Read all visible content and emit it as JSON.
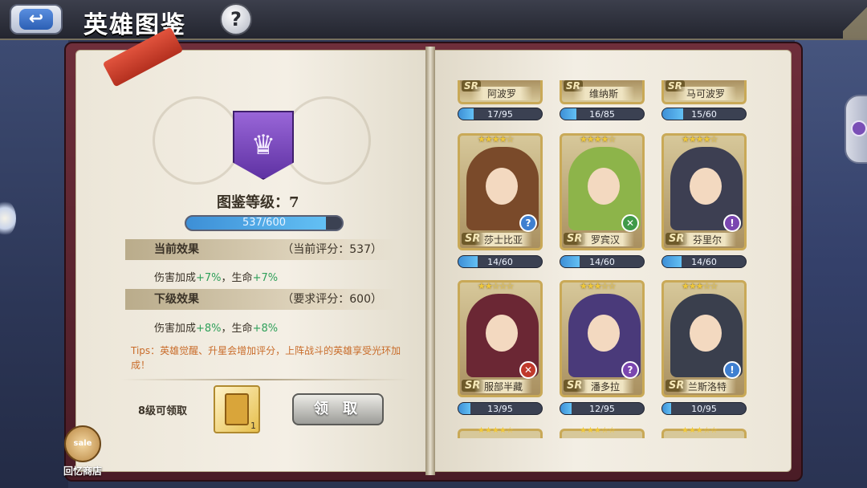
{
  "header": {
    "back_icon": "back-arrow-icon",
    "title": "英雄图鉴",
    "help_label": "?"
  },
  "left_page": {
    "emblem_icon": "winged-crown-emblem-icon",
    "level_label": "图鉴等级：7",
    "progress_text": "537/600",
    "progress_fraction": 0.895,
    "current": {
      "title": "当前效果",
      "score": "（当前评分：537）",
      "effect_prefix": "伤害加成",
      "effect_dmg": "+7%",
      "effect_mid": "，生命",
      "effect_hp": "+7%"
    },
    "next": {
      "title": "下级效果",
      "score": "（要求评分：600）",
      "effect_prefix": "伤害加成",
      "effect_dmg": "+8%",
      "effect_mid": "，生命",
      "effect_hp": "+8%"
    },
    "tips": "Tips：英雄觉醒、升星会增加评分，上阵战斗的英雄享受光环加成！",
    "claim_label": "8级可领取",
    "reward_count": "1",
    "claim_button": "领 取"
  },
  "shop": {
    "badge": "sale",
    "label": "回忆商店"
  },
  "heroes_top": [
    {
      "name": "阿波罗",
      "progress": "17/95",
      "fraction": 0.18
    },
    {
      "name": "维纳斯",
      "progress": "16/85",
      "fraction": 0.19
    },
    {
      "name": "马可波罗",
      "progress": "15/60",
      "fraction": 0.25
    }
  ],
  "heroes": [
    {
      "name": "莎士比亚",
      "stars": "★★★★☆",
      "rarity": "SR",
      "class_icon": "question-class-icon",
      "class_glyph": "?",
      "class_color": "#3f7fd0",
      "progress": "14/60",
      "fraction": 0.23,
      "art_color": "#7a4a2a"
    },
    {
      "name": "罗宾汉",
      "stars": "★★★★☆",
      "rarity": "SR",
      "class_icon": "crossed-bow-class-icon",
      "class_glyph": "✕",
      "class_color": "#3f9a48",
      "progress": "14/60",
      "fraction": 0.23,
      "art_color": "#8db44a"
    },
    {
      "name": "芬里尔",
      "stars": "★★★★☆",
      "rarity": "SR",
      "class_icon": "exclaim-class-icon",
      "class_glyph": "!",
      "class_color": "#7a46b0",
      "progress": "14/60",
      "fraction": 0.23,
      "art_color": "#3d3f52"
    },
    {
      "name": "服部半藏",
      "stars": "★★☆☆☆",
      "rarity": "SR",
      "class_icon": "crossed-blade-class-icon",
      "class_glyph": "✕",
      "class_color": "#c0392b",
      "progress": "13/95",
      "fraction": 0.14,
      "art_color": "#6b2734"
    },
    {
      "name": "潘多拉",
      "stars": "★★★☆☆",
      "rarity": "SR",
      "class_icon": "question-class-icon",
      "class_glyph": "?",
      "class_color": "#7a46b0",
      "progress": "12/95",
      "fraction": 0.13,
      "art_color": "#4a3a7a"
    },
    {
      "name": "兰斯洛特",
      "stars": "★★★☆☆",
      "rarity": "SR",
      "class_icon": "exclaim-class-icon",
      "class_glyph": "!",
      "class_color": "#3f7fd0",
      "progress": "10/95",
      "fraction": 0.11,
      "art_color": "#3a3f4d"
    }
  ],
  "heroes_bottom_stars": [
    "★★★★☆",
    "★★★☆☆",
    "★★★☆☆"
  ]
}
